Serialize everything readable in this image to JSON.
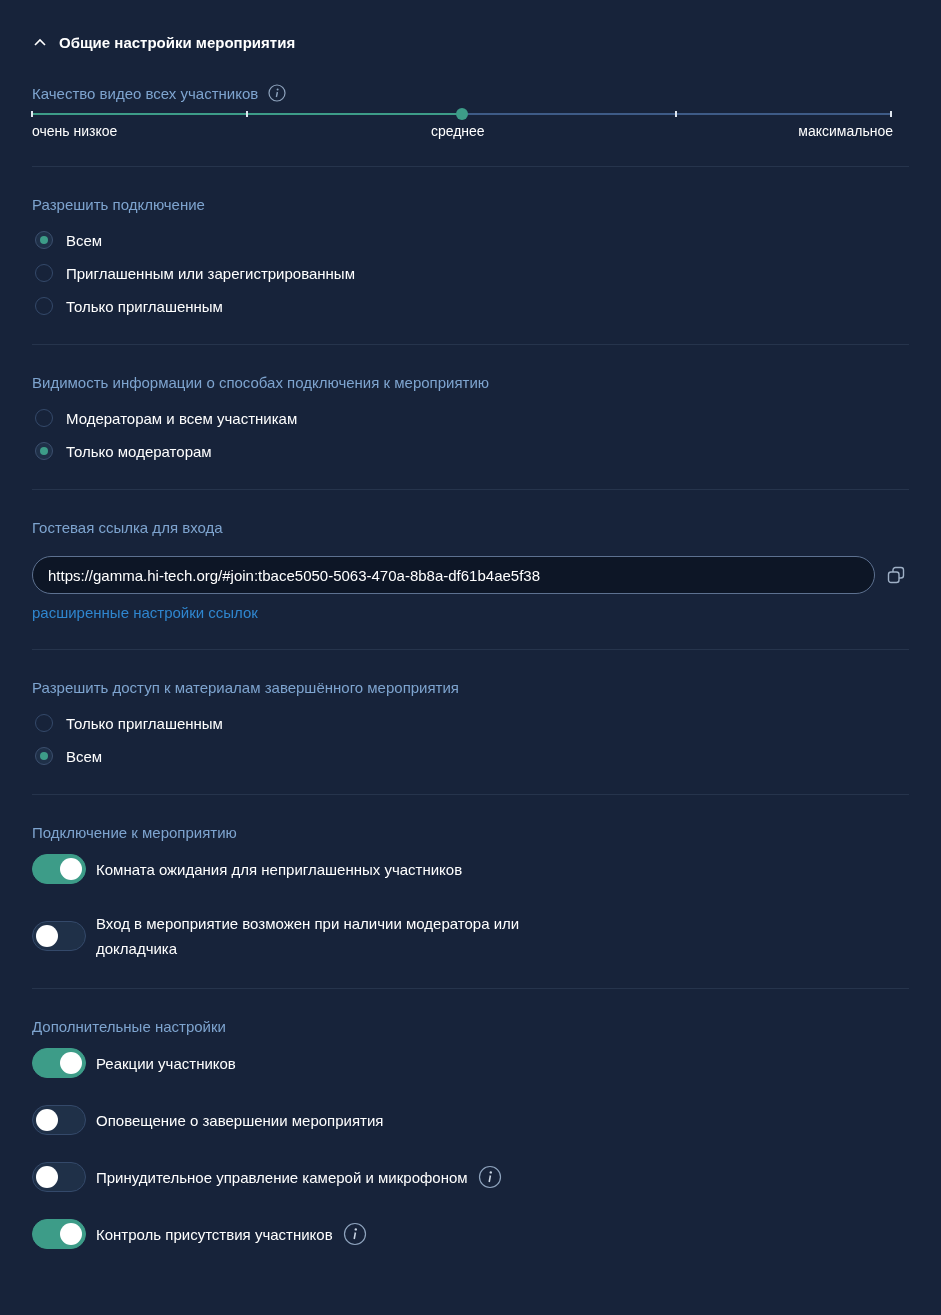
{
  "header": {
    "title": "Общие настройки мероприятия",
    "expanded": true
  },
  "sections": [
    {
      "kind": "slider",
      "title": "Качество видео всех участников",
      "info": true,
      "level": 0.5,
      "labels": [
        "очень низкое",
        "среднее",
        "максимальное"
      ]
    },
    {
      "kind": "radio",
      "title": "Разрешить подключение",
      "options": [
        {
          "label": "Всем",
          "selected": true
        },
        {
          "label": "Приглашенным или зарегистрированным",
          "selected": false
        },
        {
          "label": "Только приглашенным",
          "selected": false
        }
      ]
    },
    {
      "kind": "radio",
      "title": "Видимость информации о способах подключения к мероприятию",
      "options": [
        {
          "label": "Модераторам и всем участникам",
          "selected": false
        },
        {
          "label": "Только модераторам",
          "selected": true
        }
      ]
    },
    {
      "kind": "link",
      "title": "Гостевая ссылка для входа",
      "value": "https://gamma.hi-tech.org/#join:tbace5050-5063-470a-8b8a-df61b4ae5f38",
      "link": "расширенные настройки ссылок"
    },
    {
      "kind": "radio",
      "title": "Разрешить доступ к материалам завершённого мероприятия",
      "options": [
        {
          "label": "Только приглашенным",
          "selected": false
        },
        {
          "label": "Всем",
          "selected": true
        }
      ]
    },
    {
      "kind": "toggles",
      "title": "Подключение к мероприятию",
      "options": [
        {
          "label": "Комната ожидания для неприглашенных участников",
          "on": true,
          "info": false
        },
        {
          "label": "Вход в мероприятие возможен при наличии модератора или докладчика",
          "on": false,
          "info": false
        }
      ]
    },
    {
      "kind": "toggles",
      "title": "Дополнительные настройки",
      "options": [
        {
          "label": "Реакции участников",
          "on": true,
          "info": false
        },
        {
          "label": "Оповещение о завершении мероприятия",
          "on": false,
          "info": false
        },
        {
          "label": "Принудительное управление камерой и микрофоном",
          "on": false,
          "info": true
        },
        {
          "label": "Контроль присутствия участников",
          "on": true,
          "info": true
        }
      ]
    }
  ]
}
